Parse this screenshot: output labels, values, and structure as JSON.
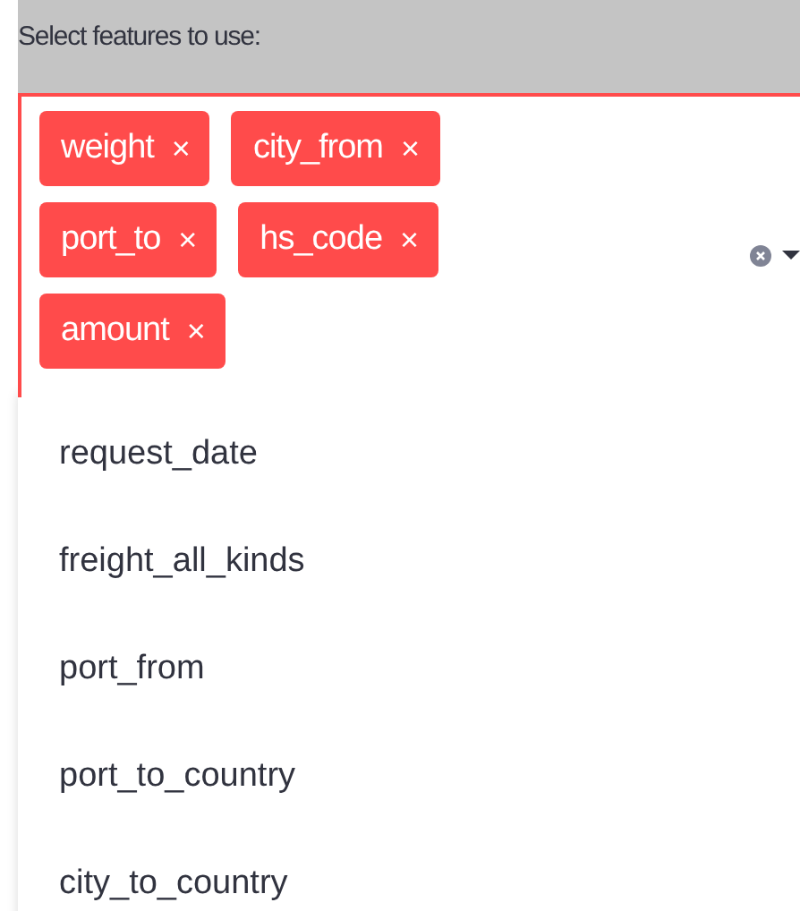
{
  "label": "Select features to use:",
  "selected_tags": [
    {
      "text": "weight",
      "remove": "×"
    },
    {
      "text": "city_from",
      "remove": "×"
    },
    {
      "text": "port_to",
      "remove": "×"
    },
    {
      "text": "hs_code",
      "remove": "×"
    },
    {
      "text": "amount",
      "remove": "×"
    }
  ],
  "options": [
    "request_date",
    "freight_all_kinds",
    "port_from",
    "port_to_country",
    "city_to_country"
  ]
}
